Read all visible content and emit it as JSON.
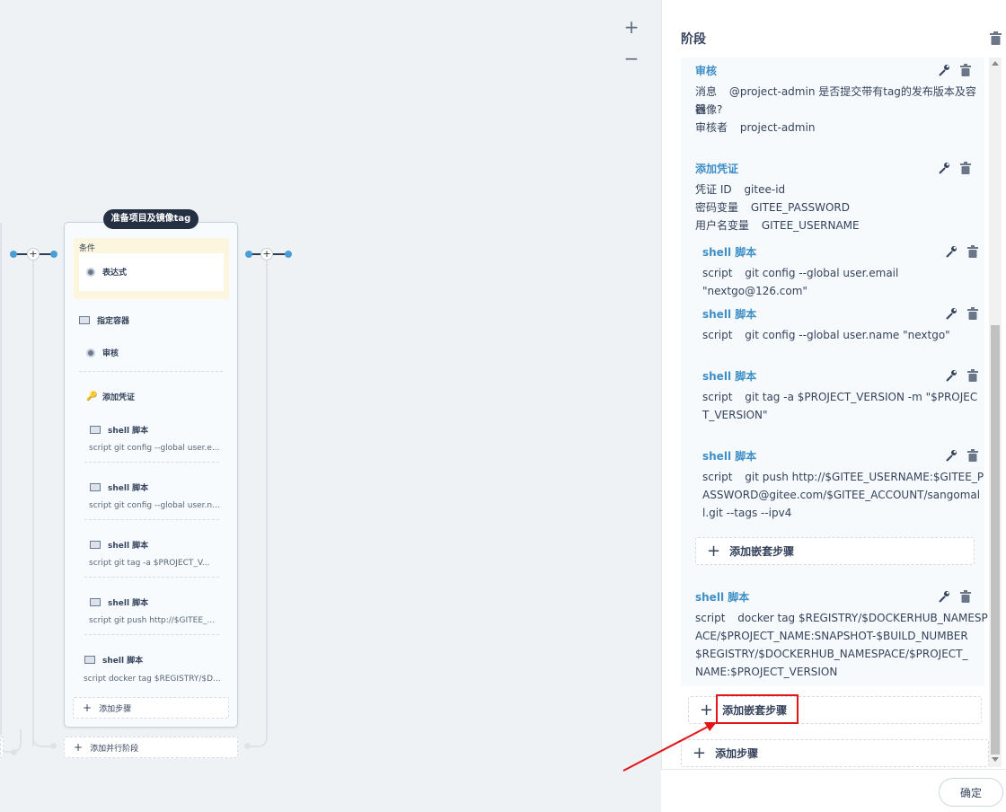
{
  "canvas": {
    "zoom_in": "+",
    "zoom_out": "−",
    "stage": {
      "title": "准备项目及镜像tag",
      "condition_label": "条件",
      "expression": "表达式",
      "container": "指定容器",
      "review": "审核",
      "add_credential": "添加凭证",
      "shell_items": [
        {
          "name": "shell 脚本",
          "script": "script   git config --global user.e..."
        },
        {
          "name": "shell 脚本",
          "script": "script   git config --global user.n..."
        },
        {
          "name": "shell 脚本",
          "script": "script   git tag -a $PROJECT_V..."
        },
        {
          "name": "shell 脚本",
          "script": "script   git push http://$GITEE_..."
        }
      ],
      "docker_item": {
        "name": "shell 脚本",
        "script": "script   docker tag $REGISTRY/$D..."
      },
      "add_step": "添加步骤"
    },
    "add_parallel": "添加并行阶段"
  },
  "panel": {
    "title": "阶段",
    "review": {
      "name": "审核",
      "msg_key": "消息",
      "msg_val_1": "@project-admin 是否提交带有tag的发布版本及容器",
      "msg_val_2": "镜像?",
      "reviewer_key": "审核者",
      "reviewer_val": "project-admin"
    },
    "credential": {
      "name": "添加凭证",
      "id_key": "凭证 ID",
      "id_val": "gitee-id",
      "pw_key": "密码变量",
      "pw_val": "GITEE_PASSWORD",
      "user_key": "用户名变量",
      "user_val": "GITEE_USERNAME"
    },
    "nested": [
      {
        "name": "shell 脚本",
        "key": "script",
        "lines": [
          "git config --global user.email \"nextgo@126.com\""
        ]
      },
      {
        "name": "shell 脚本",
        "key": "script",
        "lines": [
          "git config --global user.name \"nextgo\""
        ]
      },
      {
        "name": "shell 脚本",
        "key": "script",
        "lines": [
          "git tag -a $PROJECT_VERSION -m \"$PROJEC",
          "T_VERSION\""
        ]
      },
      {
        "name": "shell 脚本",
        "key": "script",
        "lines": [
          "git push http://$GITEE_USERNAME:$GITEE_P",
          "ASSWORD@gitee.com/$GITEE_ACCOUNT/sangomal",
          "l.git --tags --ipv4"
        ]
      }
    ],
    "add_nested_inner": "添加嵌套步骤",
    "docker": {
      "name": "shell 脚本",
      "key": "script",
      "lines": [
        "docker tag $REGISTRY/$DOCKERHUB_NAMESP",
        "ACE/$PROJECT_NAME:SNAPSHOT-$BUILD_NUMBER",
        "$REGISTRY/$DOCKERHUB_NAMESPACE/$PROJECT_",
        "NAME:$PROJECT_VERSION"
      ]
    },
    "add_nested_outer": "添加嵌套步骤",
    "add_step": "添加步骤",
    "confirm": "确定"
  }
}
